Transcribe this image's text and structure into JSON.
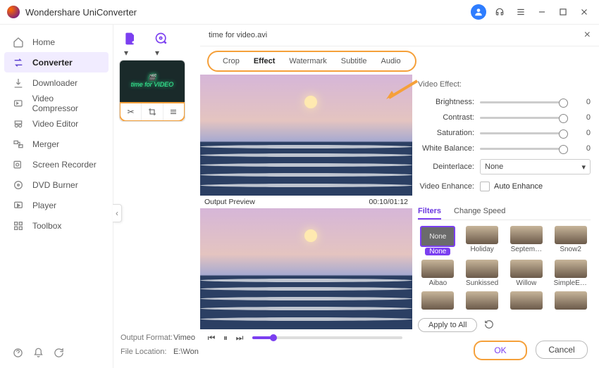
{
  "app": {
    "title": "Wondershare UniConverter"
  },
  "sidebar": {
    "items": [
      {
        "label": "Home"
      },
      {
        "label": "Converter"
      },
      {
        "label": "Downloader"
      },
      {
        "label": "Video Compressor"
      },
      {
        "label": "Video Editor"
      },
      {
        "label": "Merger"
      },
      {
        "label": "Screen Recorder"
      },
      {
        "label": "DVD Burner"
      },
      {
        "label": "Player"
      },
      {
        "label": "Toolbox"
      }
    ]
  },
  "file": {
    "thumb_text": "time for\nVIDEO",
    "output_format_label": "Output Format:",
    "output_format_value": "Vimeo",
    "file_location_label": "File Location:",
    "file_location_value": "E:\\Won"
  },
  "editor": {
    "filename": "time for video.avi",
    "tabs": [
      "Crop",
      "Effect",
      "Watermark",
      "Subtitle",
      "Audio"
    ],
    "active_tab": "Effect",
    "preview_label": "Output Preview",
    "time": "00:10/01:12",
    "transport_progress_pct": 14
  },
  "effects": {
    "section": "Video Effect:",
    "rows": [
      {
        "label": "Brightness:",
        "value": "0"
      },
      {
        "label": "Contrast:",
        "value": "0"
      },
      {
        "label": "Saturation:",
        "value": "0"
      },
      {
        "label": "White Balance:",
        "value": "0"
      }
    ],
    "deinterlace_label": "Deinterlace:",
    "deinterlace_value": "None",
    "enhance_label": "Video Enhance:",
    "enhance_option": "Auto Enhance"
  },
  "filters": {
    "tabs": [
      "Filters",
      "Change Speed"
    ],
    "items": [
      "None",
      "Holiday",
      "Septem…",
      "Snow2",
      "Aibao",
      "Sunkissed",
      "Willow",
      "SimpleEl…",
      "",
      "",
      "",
      ""
    ],
    "apply_label": "Apply to All"
  },
  "buttons": {
    "ok": "OK",
    "cancel": "Cancel"
  }
}
